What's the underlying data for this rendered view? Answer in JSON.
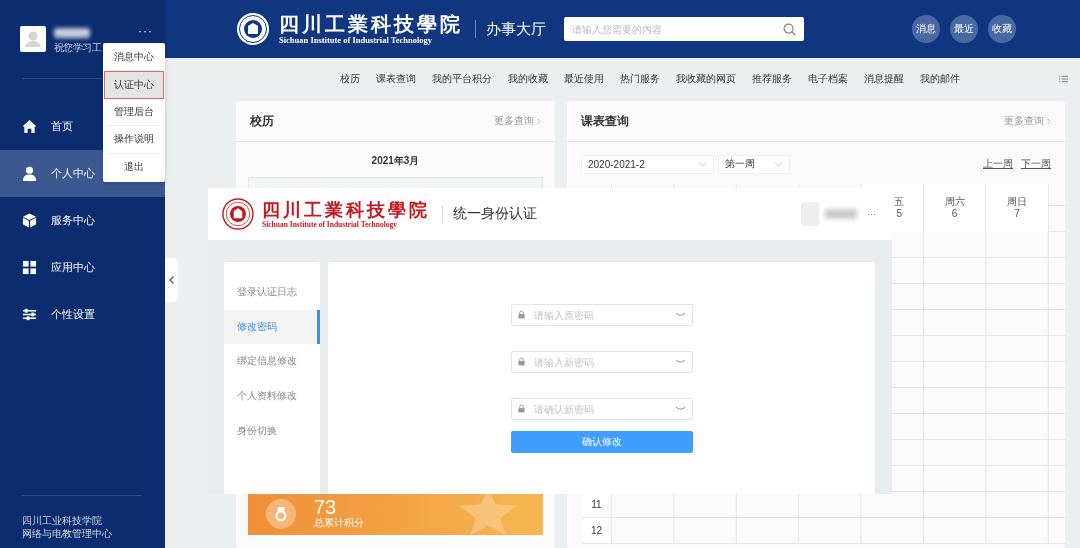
{
  "sidebar": {
    "greeting": "祝您学习工",
    "more": "···",
    "menu": [
      {
        "label": "首页",
        "selected": false
      },
      {
        "label": "个人中心",
        "selected": true
      },
      {
        "label": "服务中心",
        "selected": false
      },
      {
        "label": "应用中心",
        "selected": false
      },
      {
        "label": "个性设置",
        "selected": false
      }
    ],
    "footer": [
      "四川工业科技学院",
      "网络与电教管理中心"
    ]
  },
  "user_dropdown": {
    "items": [
      {
        "label": "消息中心",
        "selected": false
      },
      {
        "label": "认证中心",
        "selected": true
      },
      {
        "label": "管理后台",
        "selected": false
      },
      {
        "label": "操作说明",
        "selected": false
      },
      {
        "label": "退出",
        "selected": false
      }
    ]
  },
  "header": {
    "school_name": "四川工業科技學院",
    "school_name_en": "Sichuan Institute of Industrial Technology",
    "section": "办事大厅",
    "search": {
      "placeholder": "请输入您需要的内容"
    },
    "buttons": [
      "消息",
      "最近",
      "收藏"
    ]
  },
  "nav": {
    "items": [
      "校历",
      "课表查询",
      "我的平台积分",
      "我的收藏",
      "最近使用",
      "热门服务",
      "我收藏的网页",
      "推荐服务",
      "电子档案",
      "消息提醒",
      "我的邮件"
    ]
  },
  "calendar_card": {
    "title": "校历",
    "more": "更多查询",
    "month": "2021年3月"
  },
  "points_card": {
    "value": "73",
    "label": "总累计积分"
  },
  "schedule_card": {
    "title": "课表查询",
    "more": "更多查询",
    "term": "2020-2021-2",
    "week": "第一周",
    "prev": "上一周",
    "next": "下一周",
    "day_headers": [
      {
        "day": "五",
        "date": "5"
      },
      {
        "day": "周六",
        "date": "6"
      },
      {
        "day": "周日",
        "date": "7"
      }
    ],
    "row_numbers": [
      "11",
      "12"
    ]
  },
  "auth_window": {
    "school_name": "四川工業科技學院",
    "school_name_en": "Sichuan Institute of Industrial Technology",
    "title": "统一身份认证",
    "more": "···",
    "menu": [
      {
        "label": "登录认证日志",
        "selected": false
      },
      {
        "label": "修改密码",
        "selected": true
      },
      {
        "label": "绑定信息修改",
        "selected": false
      },
      {
        "label": "个人资料修改",
        "selected": false
      },
      {
        "label": "身份切换",
        "selected": false
      }
    ],
    "fields": [
      {
        "placeholder": "请输入原密码"
      },
      {
        "placeholder": "请输入新密码"
      },
      {
        "placeholder": "请确认新密码"
      }
    ],
    "submit": "确认修改"
  }
}
